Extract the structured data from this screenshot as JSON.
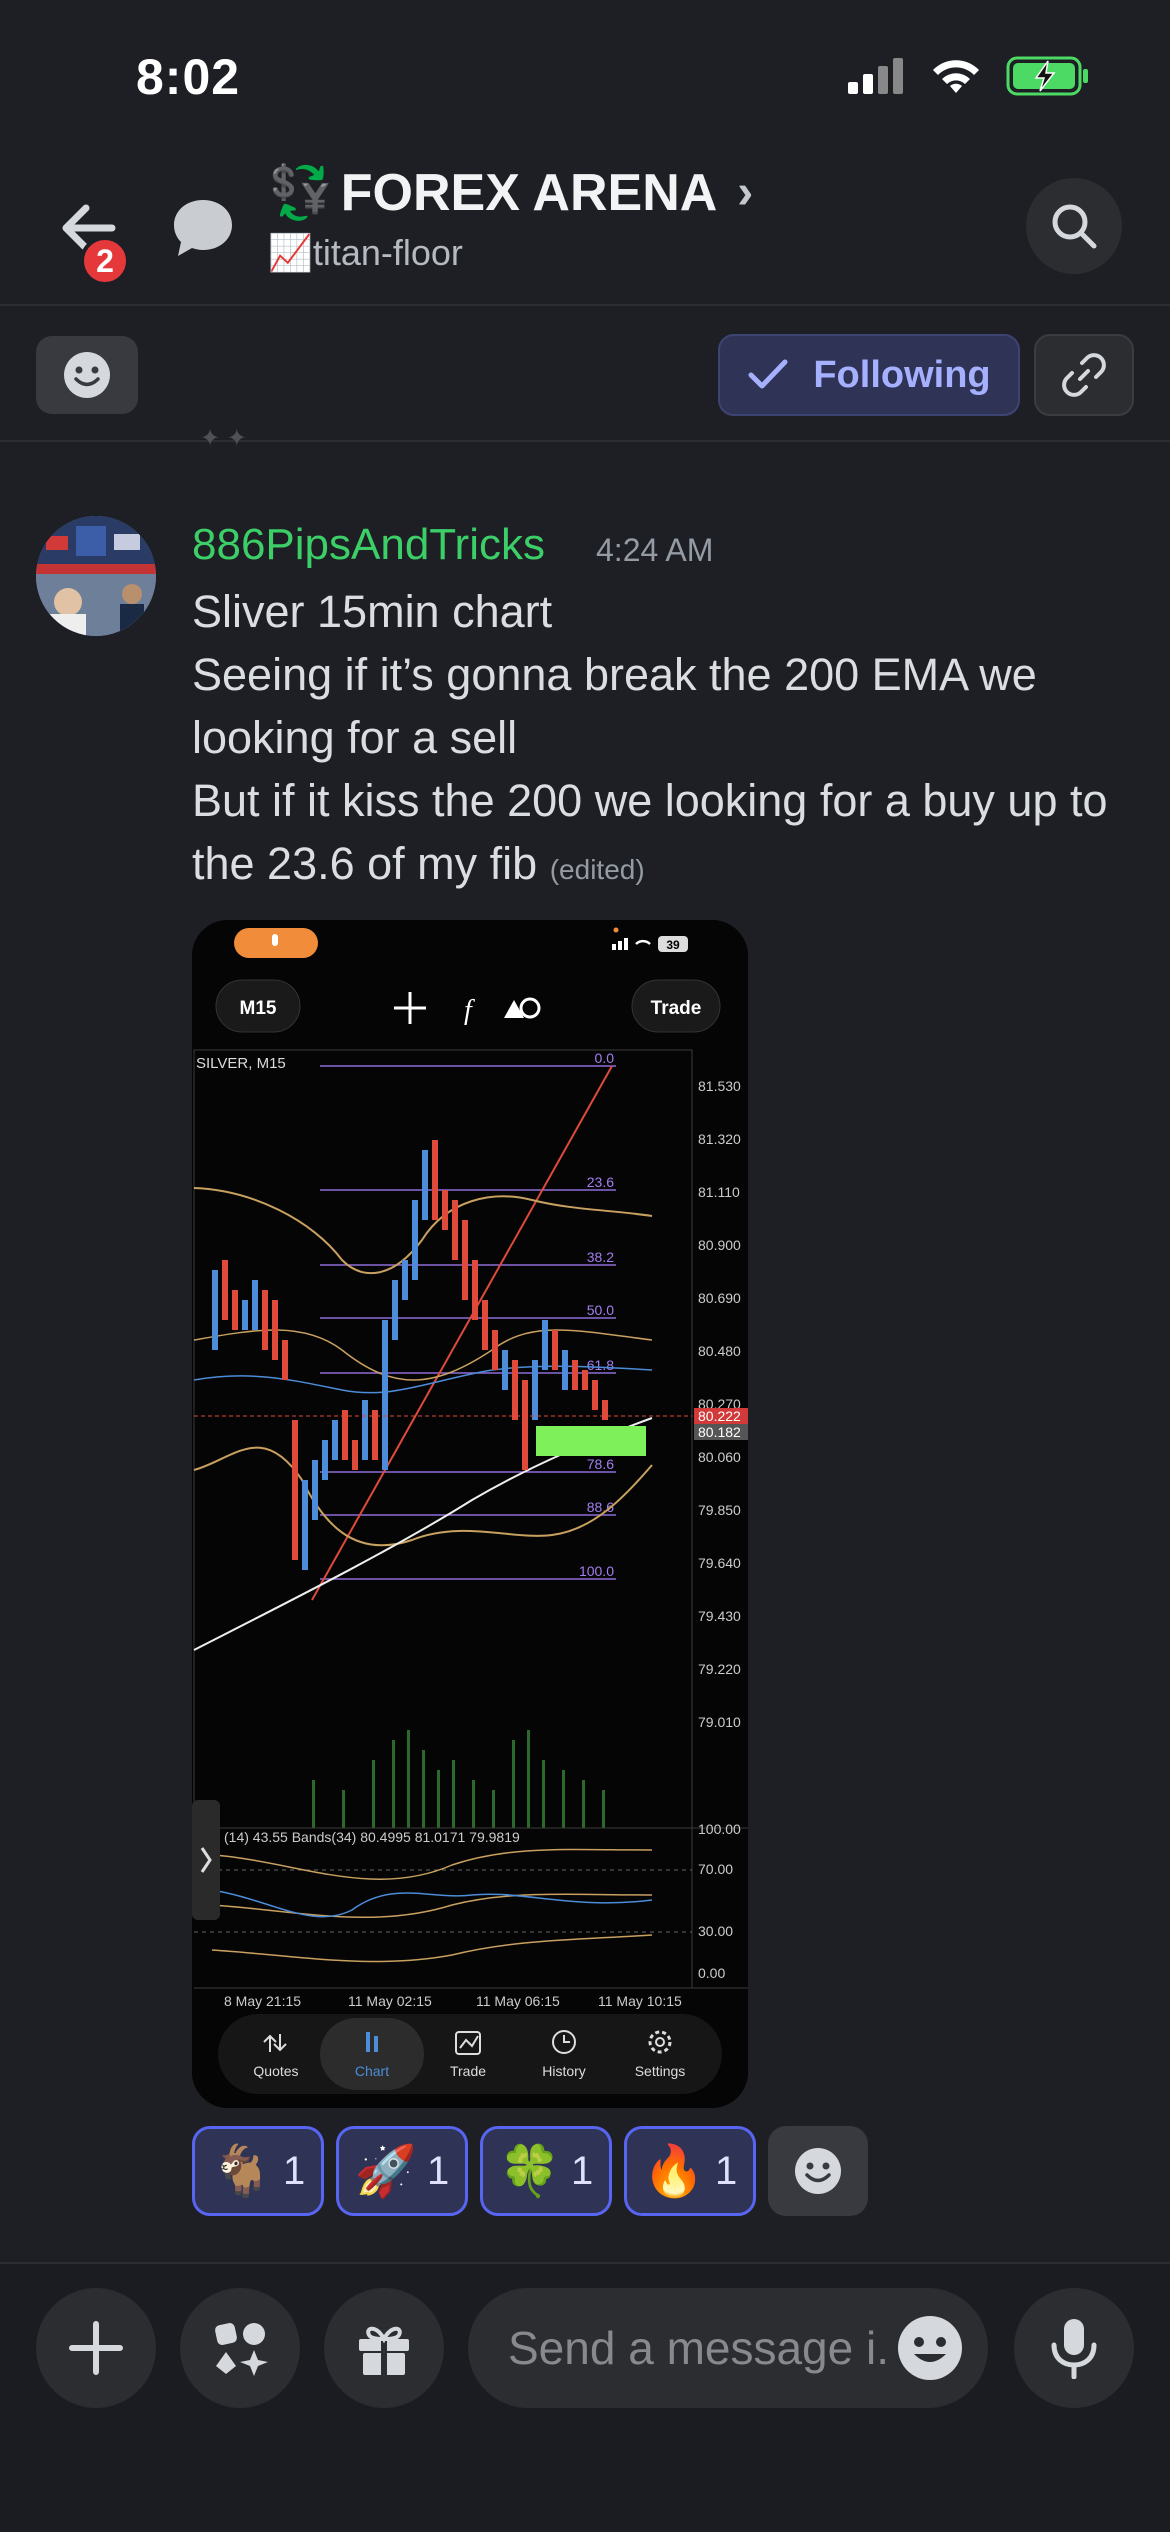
{
  "status_bar": {
    "time": "8:02"
  },
  "header": {
    "badge_count": "2",
    "server_prefix": "💱",
    "server_name": "FOREX ARENA",
    "channel_prefix": "📈",
    "channel_name": "titan-floor"
  },
  "actions": {
    "following_label": "Following"
  },
  "message": {
    "username": "886PipsAndTricks",
    "timestamp": "4:24 AM",
    "line1": "Sliver 15min chart",
    "line2": "Seeing if it’s gonna break the 200 EMA we looking for a sell",
    "line3": "But if it kiss the 200 we looking for a buy up to the 23.6 of my fib",
    "edited": "(edited)",
    "username_color": "#3ccf68"
  },
  "attachment": {
    "battery": "39",
    "timeframe": "M15",
    "trade_button": "Trade",
    "symbol_label": "SILVER, M15",
    "fib_levels": [
      "0.0",
      "23.6",
      "38.2",
      "50.0",
      "61.8",
      "78.6",
      "88.6",
      "100.0"
    ],
    "price_ticks": [
      "81.530",
      "81.320",
      "81.110",
      "80.900",
      "80.690",
      "80.480",
      "80.270",
      "80.060",
      "79.850",
      "79.640",
      "79.430",
      "79.220",
      "79.010"
    ],
    "current_price_red": "80.222",
    "current_price_gray": "80.182",
    "indicator_label": "(14) 43.55 Bands(34) 80.4995 81.0171 79.9819",
    "indicator_ticks": [
      "100.00",
      "70.00",
      "30.00",
      "0.00"
    ],
    "time_labels": [
      "8 May 21:15",
      "11 May 02:15",
      "11 May 06:15",
      "11 May 10:15"
    ],
    "tabs": [
      "Quotes",
      "Chart",
      "Trade",
      "History",
      "Settings"
    ]
  },
  "reactions": [
    {
      "emoji": "🐐",
      "count": "1"
    },
    {
      "emoji": "🚀",
      "count": "1"
    },
    {
      "emoji": "🍀",
      "count": "1"
    },
    {
      "emoji": "🔥",
      "count": "1"
    }
  ],
  "composer": {
    "placeholder": "Send a message i..."
  },
  "colors": {
    "accent": "#5865f2",
    "badge": "#e5383b",
    "background": "#1e1f24"
  }
}
